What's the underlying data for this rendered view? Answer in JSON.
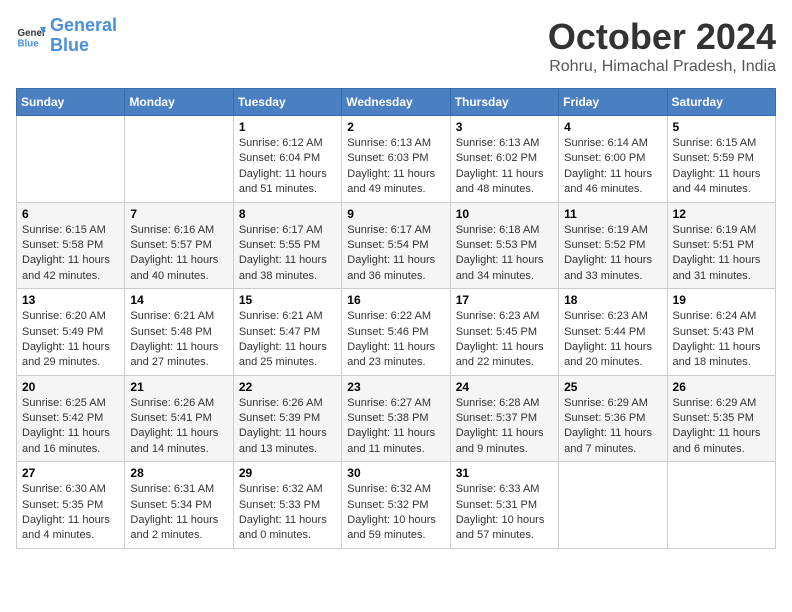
{
  "header": {
    "logo_text_general": "General",
    "logo_text_blue": "Blue",
    "month_title": "October 2024",
    "location": "Rohru, Himachal Pradesh, India"
  },
  "calendar": {
    "weekdays": [
      "Sunday",
      "Monday",
      "Tuesday",
      "Wednesday",
      "Thursday",
      "Friday",
      "Saturday"
    ],
    "weeks": [
      [
        {
          "day": "",
          "info": ""
        },
        {
          "day": "",
          "info": ""
        },
        {
          "day": "1",
          "info": "Sunrise: 6:12 AM\nSunset: 6:04 PM\nDaylight: 11 hours\nand 51 minutes."
        },
        {
          "day": "2",
          "info": "Sunrise: 6:13 AM\nSunset: 6:03 PM\nDaylight: 11 hours\nand 49 minutes."
        },
        {
          "day": "3",
          "info": "Sunrise: 6:13 AM\nSunset: 6:02 PM\nDaylight: 11 hours\nand 48 minutes."
        },
        {
          "day": "4",
          "info": "Sunrise: 6:14 AM\nSunset: 6:00 PM\nDaylight: 11 hours\nand 46 minutes."
        },
        {
          "day": "5",
          "info": "Sunrise: 6:15 AM\nSunset: 5:59 PM\nDaylight: 11 hours\nand 44 minutes."
        }
      ],
      [
        {
          "day": "6",
          "info": "Sunrise: 6:15 AM\nSunset: 5:58 PM\nDaylight: 11 hours\nand 42 minutes."
        },
        {
          "day": "7",
          "info": "Sunrise: 6:16 AM\nSunset: 5:57 PM\nDaylight: 11 hours\nand 40 minutes."
        },
        {
          "day": "8",
          "info": "Sunrise: 6:17 AM\nSunset: 5:55 PM\nDaylight: 11 hours\nand 38 minutes."
        },
        {
          "day": "9",
          "info": "Sunrise: 6:17 AM\nSunset: 5:54 PM\nDaylight: 11 hours\nand 36 minutes."
        },
        {
          "day": "10",
          "info": "Sunrise: 6:18 AM\nSunset: 5:53 PM\nDaylight: 11 hours\nand 34 minutes."
        },
        {
          "day": "11",
          "info": "Sunrise: 6:19 AM\nSunset: 5:52 PM\nDaylight: 11 hours\nand 33 minutes."
        },
        {
          "day": "12",
          "info": "Sunrise: 6:19 AM\nSunset: 5:51 PM\nDaylight: 11 hours\nand 31 minutes."
        }
      ],
      [
        {
          "day": "13",
          "info": "Sunrise: 6:20 AM\nSunset: 5:49 PM\nDaylight: 11 hours\nand 29 minutes."
        },
        {
          "day": "14",
          "info": "Sunrise: 6:21 AM\nSunset: 5:48 PM\nDaylight: 11 hours\nand 27 minutes."
        },
        {
          "day": "15",
          "info": "Sunrise: 6:21 AM\nSunset: 5:47 PM\nDaylight: 11 hours\nand 25 minutes."
        },
        {
          "day": "16",
          "info": "Sunrise: 6:22 AM\nSunset: 5:46 PM\nDaylight: 11 hours\nand 23 minutes."
        },
        {
          "day": "17",
          "info": "Sunrise: 6:23 AM\nSunset: 5:45 PM\nDaylight: 11 hours\nand 22 minutes."
        },
        {
          "day": "18",
          "info": "Sunrise: 6:23 AM\nSunset: 5:44 PM\nDaylight: 11 hours\nand 20 minutes."
        },
        {
          "day": "19",
          "info": "Sunrise: 6:24 AM\nSunset: 5:43 PM\nDaylight: 11 hours\nand 18 minutes."
        }
      ],
      [
        {
          "day": "20",
          "info": "Sunrise: 6:25 AM\nSunset: 5:42 PM\nDaylight: 11 hours\nand 16 minutes."
        },
        {
          "day": "21",
          "info": "Sunrise: 6:26 AM\nSunset: 5:41 PM\nDaylight: 11 hours\nand 14 minutes."
        },
        {
          "day": "22",
          "info": "Sunrise: 6:26 AM\nSunset: 5:39 PM\nDaylight: 11 hours\nand 13 minutes."
        },
        {
          "day": "23",
          "info": "Sunrise: 6:27 AM\nSunset: 5:38 PM\nDaylight: 11 hours\nand 11 minutes."
        },
        {
          "day": "24",
          "info": "Sunrise: 6:28 AM\nSunset: 5:37 PM\nDaylight: 11 hours\nand 9 minutes."
        },
        {
          "day": "25",
          "info": "Sunrise: 6:29 AM\nSunset: 5:36 PM\nDaylight: 11 hours\nand 7 minutes."
        },
        {
          "day": "26",
          "info": "Sunrise: 6:29 AM\nSunset: 5:35 PM\nDaylight: 11 hours\nand 6 minutes."
        }
      ],
      [
        {
          "day": "27",
          "info": "Sunrise: 6:30 AM\nSunset: 5:35 PM\nDaylight: 11 hours\nand 4 minutes."
        },
        {
          "day": "28",
          "info": "Sunrise: 6:31 AM\nSunset: 5:34 PM\nDaylight: 11 hours\nand 2 minutes."
        },
        {
          "day": "29",
          "info": "Sunrise: 6:32 AM\nSunset: 5:33 PM\nDaylight: 11 hours\nand 0 minutes."
        },
        {
          "day": "30",
          "info": "Sunrise: 6:32 AM\nSunset: 5:32 PM\nDaylight: 10 hours\nand 59 minutes."
        },
        {
          "day": "31",
          "info": "Sunrise: 6:33 AM\nSunset: 5:31 PM\nDaylight: 10 hours\nand 57 minutes."
        },
        {
          "day": "",
          "info": ""
        },
        {
          "day": "",
          "info": ""
        }
      ]
    ]
  }
}
